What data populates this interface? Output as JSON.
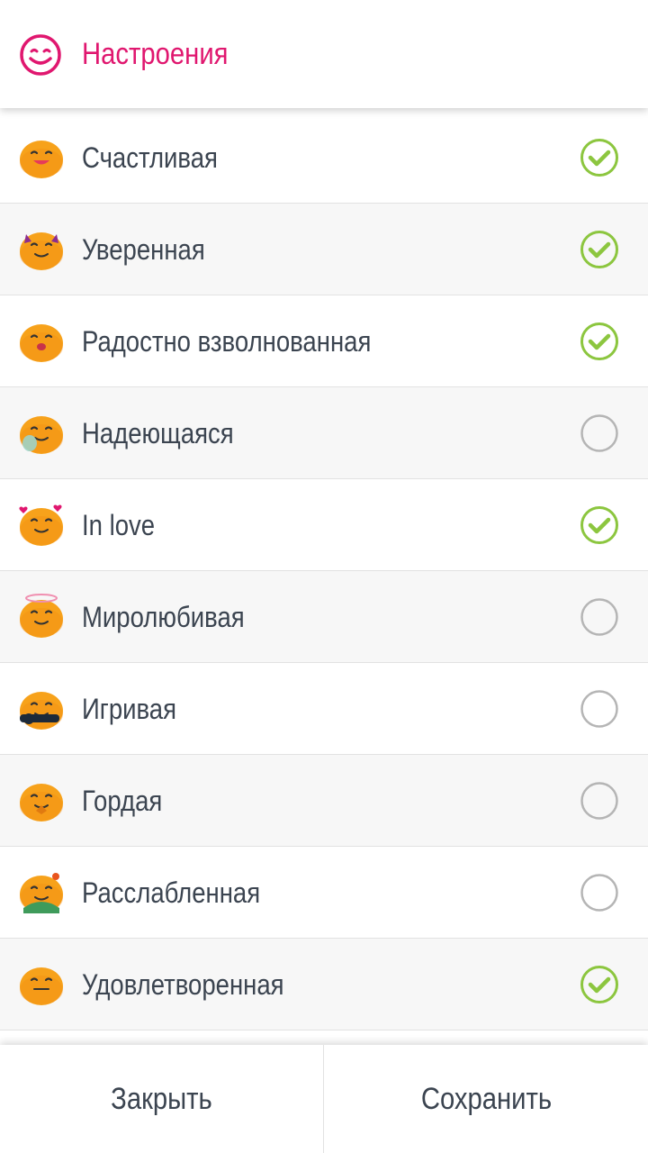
{
  "header": {
    "title": "Настроения",
    "icon": "smiley-icon",
    "accent": "#e0176f"
  },
  "moods": [
    {
      "label": "Счастливая",
      "checked": true,
      "emoji": "happy-face-icon"
    },
    {
      "label": "Уверенная",
      "checked": true,
      "emoji": "confident-face-icon"
    },
    {
      "label": "Радостно взволнованная",
      "checked": true,
      "emoji": "excited-face-icon"
    },
    {
      "label": "Надеющаяся",
      "checked": false,
      "emoji": "hopeful-face-icon"
    },
    {
      "label": "In love",
      "checked": true,
      "emoji": "in-love-face-icon"
    },
    {
      "label": "Миролюбивая",
      "checked": false,
      "emoji": "peaceful-face-icon"
    },
    {
      "label": "Игривая",
      "checked": false,
      "emoji": "playful-face-icon"
    },
    {
      "label": "Гордая",
      "checked": false,
      "emoji": "proud-face-icon"
    },
    {
      "label": "Расслабленная",
      "checked": false,
      "emoji": "relaxed-face-icon"
    },
    {
      "label": "Удовлетворенная",
      "checked": true,
      "emoji": "satisfied-face-icon"
    }
  ],
  "footer": {
    "close_label": "Закрыть",
    "save_label": "Сохранить"
  },
  "colors": {
    "check": "#8cc63f",
    "unchecked": "#b5b5b5",
    "text": "#3b4450",
    "emoji": "#f7a21b"
  }
}
